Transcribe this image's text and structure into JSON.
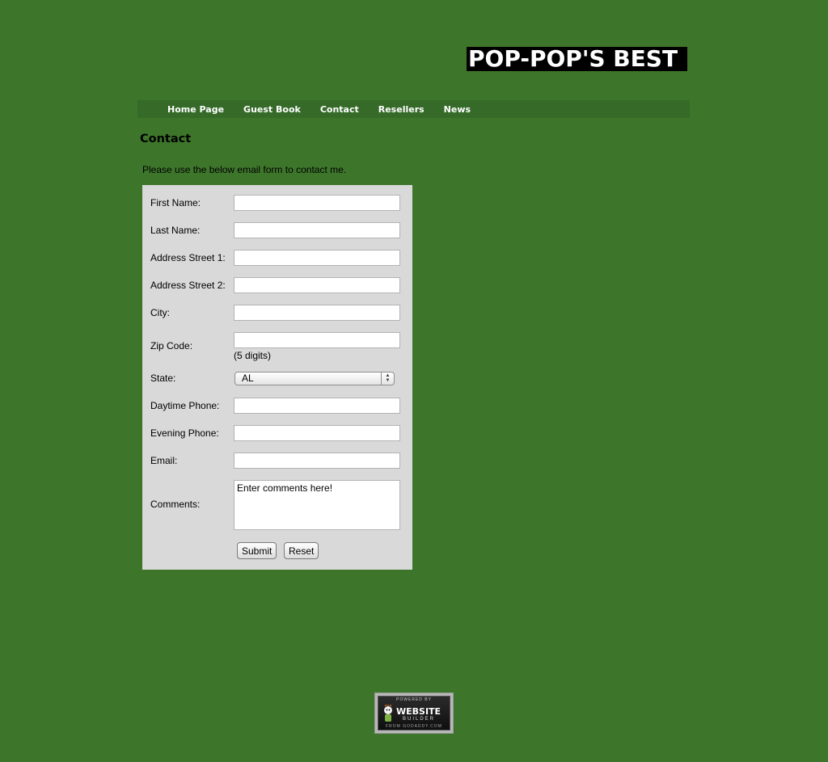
{
  "site": {
    "title": "POP-POP'S BEST"
  },
  "nav": {
    "items": [
      {
        "label": "Home Page"
      },
      {
        "label": "Guest Book"
      },
      {
        "label": "Contact"
      },
      {
        "label": "Resellers"
      },
      {
        "label": "News"
      }
    ]
  },
  "page": {
    "heading": "Contact",
    "intro": "Please use the below email form to contact me."
  },
  "form": {
    "first_name": {
      "label": "First Name:",
      "value": ""
    },
    "last_name": {
      "label": "Last Name:",
      "value": ""
    },
    "address1": {
      "label": "Address Street 1:",
      "value": ""
    },
    "address2": {
      "label": "Address Street 2:",
      "value": ""
    },
    "city": {
      "label": "City:",
      "value": ""
    },
    "zip": {
      "label": "Zip Code:",
      "value": "",
      "hint": "(5 digits)"
    },
    "state": {
      "label": "State:",
      "selected": "AL"
    },
    "day_phone": {
      "label": "Daytime Phone:",
      "value": ""
    },
    "evening_phone": {
      "label": "Evening Phone:",
      "value": ""
    },
    "email": {
      "label": "Email:",
      "value": ""
    },
    "comments": {
      "label": "Comments:",
      "value": "Enter comments here!"
    },
    "submit_label": "Submit",
    "reset_label": "Reset"
  },
  "footer": {
    "badge": {
      "top": "POWERED BY",
      "main": "WEBSITE",
      "sub": "BUILDER",
      "bottom": "FROM GODADDY.COM"
    }
  },
  "colors": {
    "background": "#3d762a",
    "navbar": "#356a28",
    "form_panel": "#d9d9d9"
  }
}
